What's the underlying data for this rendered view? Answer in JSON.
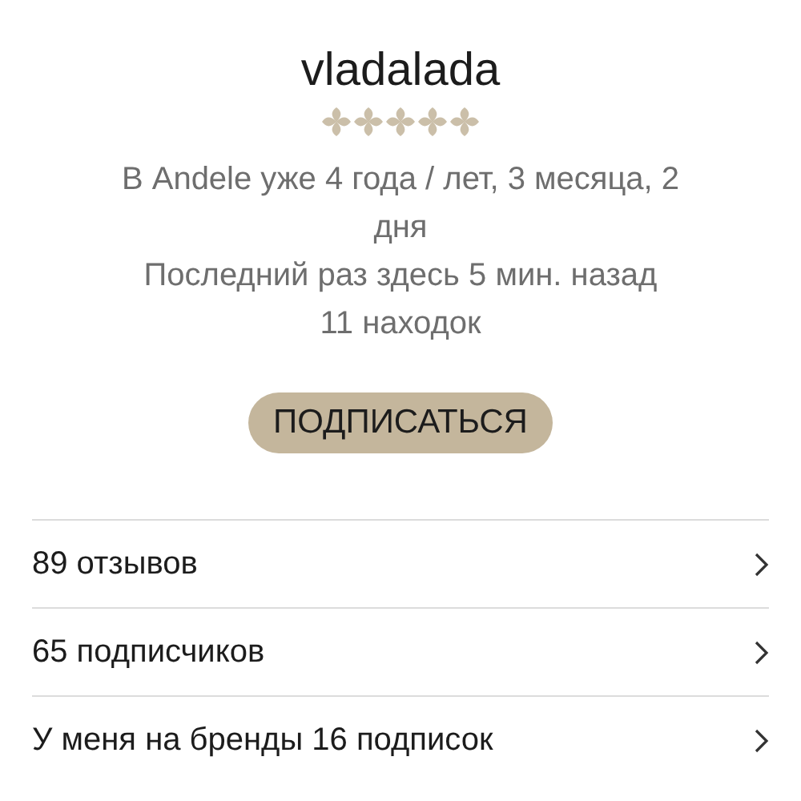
{
  "profile": {
    "username": "vladalada",
    "stars": 5,
    "details": [
      "В Andele уже 4 года / лет, 3 месяца, 2 дня",
      "Последний раз здесь 5 мин. назад",
      "11 находок"
    ],
    "subscribe_button": "ПОДПИСАТЬСЯ"
  },
  "links": [
    {
      "label": "89 отзывов"
    },
    {
      "label": "65 подписчиков"
    },
    {
      "label": "У меня на бренды 16 подписок"
    }
  ]
}
